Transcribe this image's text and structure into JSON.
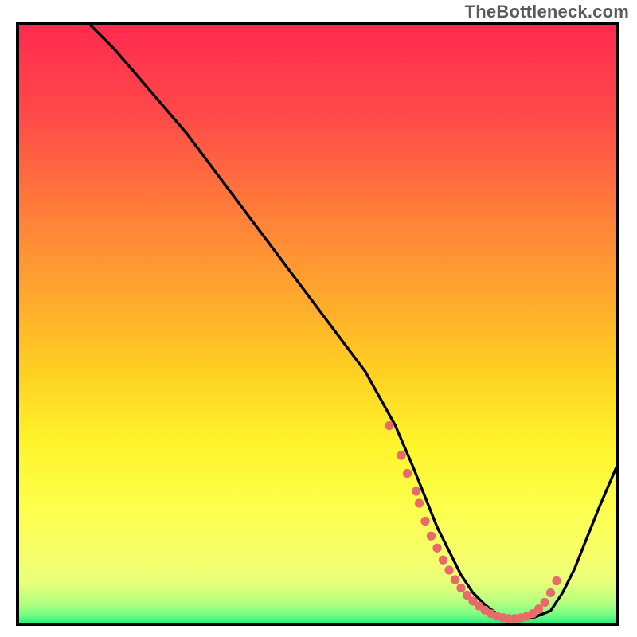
{
  "watermark": "TheBottleneck.com",
  "colors": {
    "frame_border": "#000000",
    "curve": "#000000",
    "dot": "#e86a6a",
    "gradient_stops": [
      {
        "offset": 0.0,
        "color": "#ff2a4f"
      },
      {
        "offset": 0.15,
        "color": "#ff4a49"
      },
      {
        "offset": 0.3,
        "color": "#ff7a3a"
      },
      {
        "offset": 0.45,
        "color": "#ffa72e"
      },
      {
        "offset": 0.58,
        "color": "#ffd022"
      },
      {
        "offset": 0.7,
        "color": "#fff42a"
      },
      {
        "offset": 0.8,
        "color": "#fdff4a"
      },
      {
        "offset": 0.88,
        "color": "#f8ff66"
      },
      {
        "offset": 0.93,
        "color": "#eaff7a"
      },
      {
        "offset": 0.965,
        "color": "#b8ff7e"
      },
      {
        "offset": 0.985,
        "color": "#7cff84"
      },
      {
        "offset": 1.0,
        "color": "#30f07a"
      }
    ]
  },
  "chart_data": {
    "type": "line",
    "title": "",
    "xlabel": "",
    "ylabel": "",
    "xlim": [
      0,
      100
    ],
    "ylim": [
      0,
      100
    ],
    "grid": false,
    "legend": false,
    "series": [
      {
        "name": "bottleneck-curve",
        "x": [
          12,
          16,
          22,
          28,
          34,
          40,
          46,
          52,
          58,
          63,
          66,
          68,
          70,
          72,
          74,
          76,
          78,
          80,
          82,
          84,
          86,
          89,
          91,
          93,
          95,
          97,
          100
        ],
        "y": [
          100,
          96,
          89,
          82,
          74,
          66,
          58,
          50,
          42,
          33,
          26,
          21,
          16,
          12,
          8,
          5,
          3,
          1.5,
          0.8,
          0.6,
          0.8,
          2,
          5,
          9,
          14,
          19,
          26
        ]
      }
    ],
    "highlight_points": {
      "name": "valley-dots",
      "x": [
        62,
        64,
        65,
        66.5,
        67,
        68,
        69,
        70,
        71,
        72,
        73,
        74,
        75,
        76,
        77,
        78,
        79,
        80,
        81,
        82,
        83,
        84,
        85,
        86,
        87,
        88,
        89,
        90
      ],
      "y": [
        33,
        28,
        25,
        22,
        20,
        17,
        14.5,
        12.5,
        10.5,
        8.8,
        7.2,
        5.8,
        4.6,
        3.6,
        2.8,
        2.1,
        1.5,
        1.1,
        0.85,
        0.7,
        0.7,
        0.8,
        1.05,
        1.5,
        2.3,
        3.4,
        5.0,
        7.0
      ]
    }
  }
}
